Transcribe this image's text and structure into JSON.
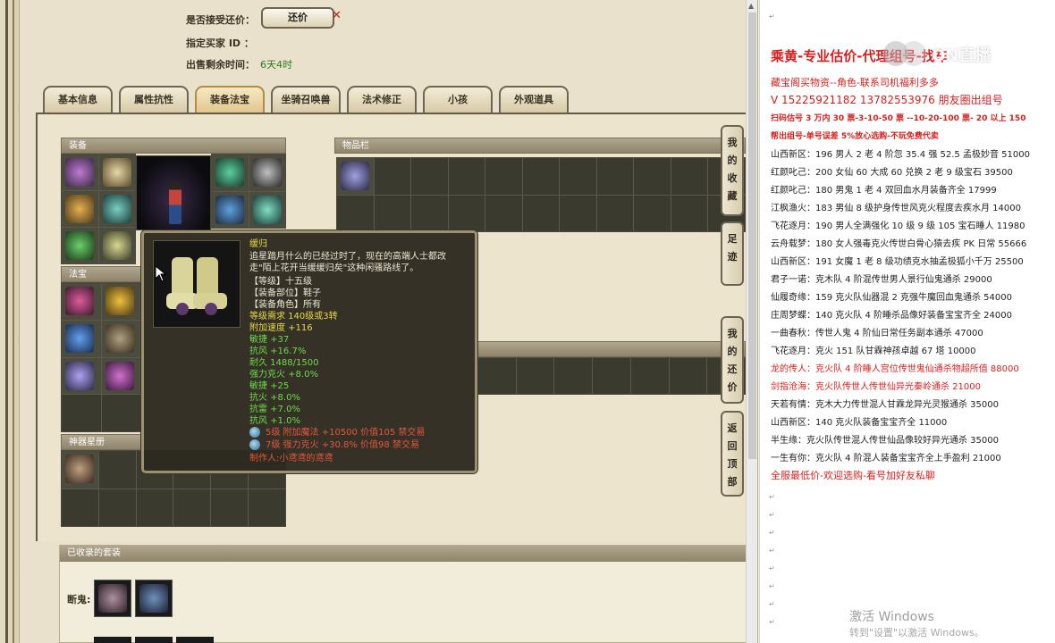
{
  "header": {
    "accept_counter_label": "是否接受还价：",
    "counter_button": "还价",
    "counter_close": "✕",
    "buyer_label": "指定买家 ID ：",
    "buyer_value": "",
    "time_label": "出售剩余时间：",
    "time_value": "6天4时"
  },
  "tabs": [
    {
      "label": "基本信息"
    },
    {
      "label": "属性抗性"
    },
    {
      "label": "装备法宝"
    },
    {
      "label": "坐骑召唤兽"
    },
    {
      "label": "法术修正"
    },
    {
      "label": "小孩"
    },
    {
      "label": "外观道具"
    }
  ],
  "sections": {
    "equipment": "装备",
    "items": "物品栏",
    "treasure": "法宝",
    "star": "神器星册",
    "collected": "已收录的套装",
    "collected_row_label": "断鬼:"
  },
  "tooltip": {
    "name": "缓归",
    "desc1": "追星踏月什么的已经过时了，现在的高端人士都改",
    "desc2": "走\"陌上花开当缓缓归矣\"这种闲骚路线了。",
    "level": "【等级】十五级",
    "slot": "【装备部位】鞋子",
    "role": "【装备角色】所有",
    "req": "等级需求 140级或3转",
    "add_speed": "附加速度 +116",
    "agility": "敏捷 +37",
    "resist_wind": "抗风 +16.7%",
    "durability": "耐久 1488/1500",
    "strong_fire": "强力克火 +8.0%",
    "agility2": "敏捷 +25",
    "resist_fire": "抗火 +8.0%",
    "resist_thunder": "抗雷 +7.0%",
    "resist_wind2": "抗风 +1.0%",
    "gem1": "5级 附加魔法 +10500 价值105 禁交易",
    "gem2": "7级 强力克火 +30.8% 价值98 禁交易",
    "maker": "制作人:小鸢鸢的鸢鸢"
  },
  "side_buttons": [
    {
      "label": "我的收藏"
    },
    {
      "label": "足迹"
    },
    {
      "label": "我的还价"
    },
    {
      "label": "返回顶部"
    }
  ],
  "right_doc": {
    "title": "乘黄-专业估价-代理组号-找车",
    "line1": "藏宝阁买物资--角色-联系司机福利多多",
    "line2": "V 15225921182   13782553976 朋友圈出组号",
    "line3": "扫码估号 3 万内 30 票-3-10-50 票 --10-20-100 票- 20 以上 150",
    "line4": "帮出组号-单号误差 5%放心选购-不玩免费代卖",
    "listings": [
      {
        "text": "山西新区：196 男人 2 老 4 阶忽 35.4 强 52.5 孟极妙音 51000",
        "color": "#222222"
      },
      {
        "text": "红颜叱己：200 女仙 60 大成 60 兑换 2 老 9 级宝石 39500",
        "color": "#222222"
      },
      {
        "text": "红颜叱己：180 男鬼 1 老 4 双回血水月装备齐全 17999",
        "color": "#222222"
      },
      {
        "text": "江枫渔火：183 男仙 8 级护身传世风克火程度去疾水月 14000",
        "color": "#222222"
      },
      {
        "text": "飞花逐月：190 男人全满强化 10 级 9 级 105 宝石睡人 11980",
        "color": "#222222"
      },
      {
        "text": "云舟载梦：180 女人强毒克火传世白骨心猿去疾 PK 日常 55666",
        "color": "#222222"
      },
      {
        "text": "山西新区：191 女魔 1 老 8 级功绩克水抽孟极狐小千万 25500",
        "color": "#222222"
      },
      {
        "text": "君子一诺：克木队 4 阶混传世男人景行仙鬼通杀 29000",
        "color": "#222222"
      },
      {
        "text": "仙履奇缘：159 克火队仙器混 2 克强牛魔回血鬼通杀 54000",
        "color": "#222222"
      },
      {
        "text": "庄周梦蝶：140 克火队 4 阶睡杀品像好装备宝宝齐全 24000",
        "color": "#222222"
      },
      {
        "text": "一曲春秋：传世人鬼 4 阶仙日常任务副本通杀 47000",
        "color": "#222222"
      },
      {
        "text": "飞花逐月：克火 151 队甘霖神孩卓越 67 塔 10000",
        "color": "#222222"
      },
      {
        "text": "龙的传人：克火队 4 阶睡人宫位传世鬼仙通杀物超所值 88000",
        "color": "#d81e1e"
      },
      {
        "text": "剑指沧海：克火队传世人传世仙异光秦岭通杀 21000",
        "color": "#d81e1e"
      },
      {
        "text": "天若有情：克木大力传世混人甘霖龙异光灵猴通杀 35000",
        "color": "#222222"
      },
      {
        "text": "山西新区：140 克火队装备宝宝齐全 11000",
        "color": "#222222"
      },
      {
        "text": "半生缘：克火队传世混人传世仙品像较好异光通杀 35000",
        "color": "#222222"
      },
      {
        "text": "一生有你：克火队 4 阶混人装备宝宝齐全上手盈利 21000",
        "color": "#222222"
      }
    ],
    "footer": "全服最低价-欢迎选购-看号加好友私聊",
    "watermark": "ON直播",
    "activate_title": "激活 Windows",
    "activate_sub": "转到\"设置\"以激活 Windows。"
  }
}
